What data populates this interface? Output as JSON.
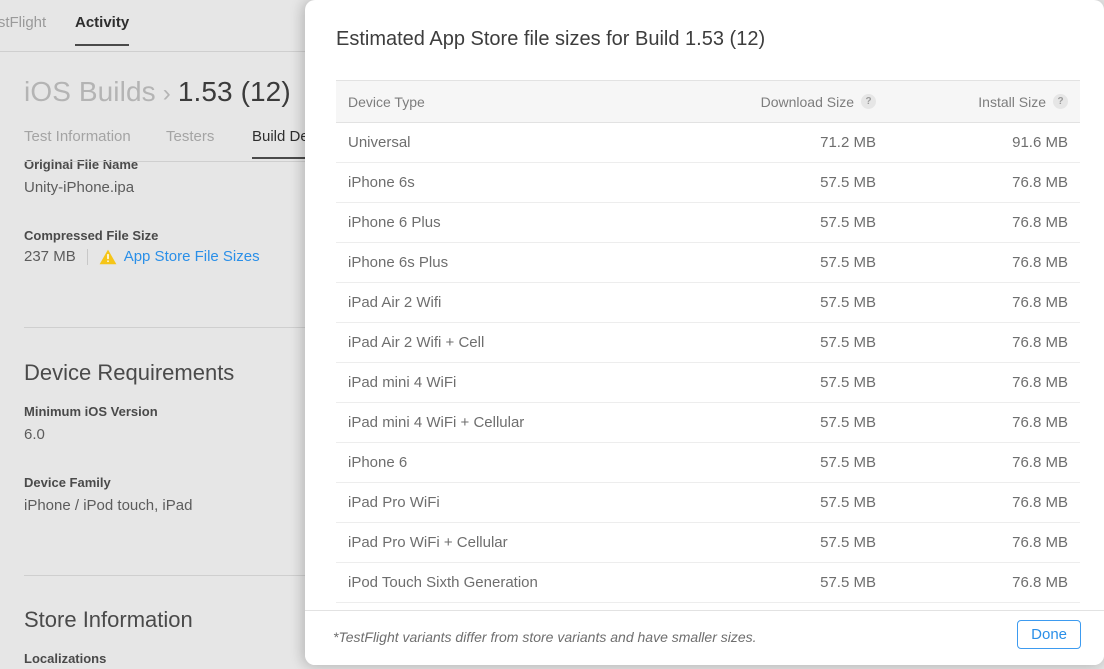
{
  "background": {
    "global_tabs": [
      {
        "label": "TestFlight",
        "active": false
      },
      {
        "label": "Activity",
        "active": true
      }
    ],
    "breadcrumb": {
      "parent": "iOS Builds",
      "separator": "›",
      "current": "1.53 (12)"
    },
    "sub_tabs": [
      {
        "label": "Test Information",
        "active": false
      },
      {
        "label": "Testers",
        "active": false
      },
      {
        "label": "Build Details",
        "active": true
      }
    ],
    "fields": {
      "original_file_name_label": "Original File Name",
      "original_file_name_value": "Unity-iPhone.ipa",
      "compressed_file_size_label": "Compressed File Size",
      "compressed_file_size_value": "237 MB",
      "app_store_file_sizes_link": "App Store File Sizes",
      "warning_icon": "warning-triangle-icon",
      "warning_color": "#f5c518"
    },
    "device_requirements": {
      "section_title": "Device Requirements",
      "minimum_ios_version_label": "Minimum iOS Version",
      "minimum_ios_version_value": "6.0",
      "device_family_label": "Device Family",
      "device_family_value": "iPhone / iPod touch, iPad"
    },
    "store_information": {
      "section_title": "Store Information",
      "localizations_label": "Localizations"
    }
  },
  "modal": {
    "title": "Estimated App Store file sizes for Build 1.53 (12)",
    "columns": {
      "device": "Device Type",
      "download": "Download Size",
      "install": "Install Size",
      "help_glyph": "?"
    },
    "rows": [
      {
        "device": "Universal",
        "download": "71.2 MB",
        "install": "91.6 MB"
      },
      {
        "device": "iPhone 6s",
        "download": "57.5 MB",
        "install": "76.8 MB"
      },
      {
        "device": "iPhone 6 Plus",
        "download": "57.5 MB",
        "install": "76.8 MB"
      },
      {
        "device": "iPhone 6s Plus",
        "download": "57.5 MB",
        "install": "76.8 MB"
      },
      {
        "device": "iPad Air 2 Wifi",
        "download": "57.5 MB",
        "install": "76.8 MB"
      },
      {
        "device": "iPad Air 2 Wifi + Cell",
        "download": "57.5 MB",
        "install": "76.8 MB"
      },
      {
        "device": "iPad mini 4 WiFi",
        "download": "57.5 MB",
        "install": "76.8 MB"
      },
      {
        "device": "iPad mini 4 WiFi + Cellular",
        "download": "57.5 MB",
        "install": "76.8 MB"
      },
      {
        "device": "iPhone 6",
        "download": "57.5 MB",
        "install": "76.8 MB"
      },
      {
        "device": "iPad Pro WiFi",
        "download": "57.5 MB",
        "install": "76.8 MB"
      },
      {
        "device": "iPad Pro WiFi + Cellular",
        "download": "57.5 MB",
        "install": "76.8 MB"
      },
      {
        "device": "iPod Touch Sixth Generation",
        "download": "57.5 MB",
        "install": "76.8 MB"
      }
    ],
    "footer_note": "*TestFlight variants differ from store variants and have smaller sizes.",
    "done_label": "Done",
    "accent_color": "#2a8fe8"
  }
}
